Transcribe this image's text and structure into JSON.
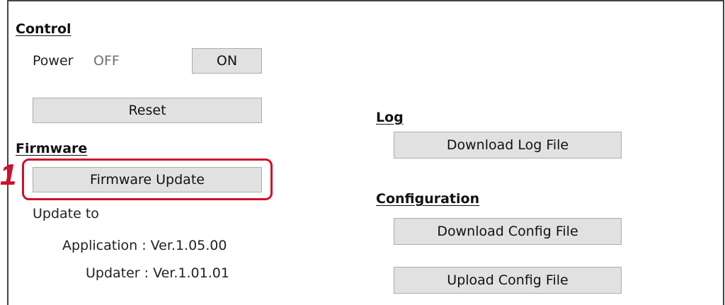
{
  "control": {
    "heading": "Control",
    "power_label": "Power",
    "power_state": "OFF",
    "on_button": "ON",
    "reset_button": "Reset"
  },
  "firmware": {
    "heading": "Firmware",
    "update_button": "Firmware Update",
    "update_to_label": "Update to",
    "application_version": "Application : Ver.1.05.00",
    "updater_version": "Updater : Ver.1.01.01"
  },
  "log": {
    "heading": "Log",
    "download_button": "Download Log File"
  },
  "configuration": {
    "heading": "Configuration",
    "download_button": "Download Config File",
    "upload_button": "Upload Config File"
  },
  "annotation": {
    "step_number": "1",
    "highlight_color": "#d0102a"
  }
}
